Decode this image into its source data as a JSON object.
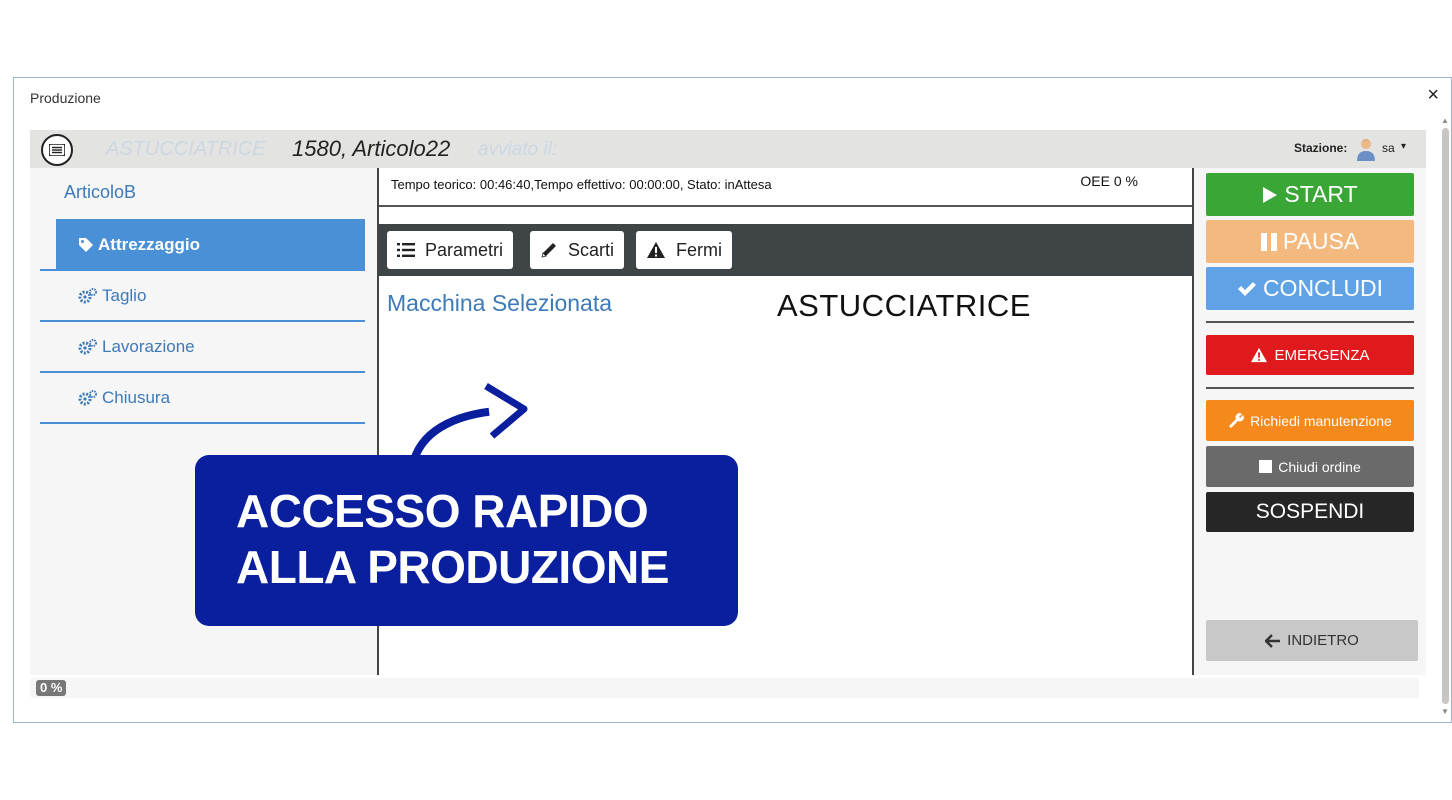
{
  "window": {
    "title": "Produzione",
    "close_glyph": "×"
  },
  "topbar": {
    "machine": "ASTUCCIATRICE",
    "order": "1580, Articolo22",
    "started": "avviato il:",
    "station_label": "Stazione:",
    "user": "sa",
    "caret": "▾"
  },
  "sidebar": {
    "header": "ArticoloB",
    "items": [
      {
        "label": "Attrezzaggio",
        "icon": "tag-icon",
        "active": true
      },
      {
        "label": "Taglio",
        "icon": "gears-icon",
        "active": false
      },
      {
        "label": "Lavorazione",
        "icon": "gears-icon",
        "active": false
      },
      {
        "label": "Chiusura",
        "icon": "gears-icon",
        "active": false
      }
    ]
  },
  "center": {
    "status": "Tempo teorico: 00:46:40,Tempo effettivo: 00:00:00, Stato: inAttesa",
    "oee": "OEE 0 %",
    "tabs": [
      {
        "label": "Parametri",
        "icon": "list-icon"
      },
      {
        "label": "Scarti",
        "icon": "pencil-icon"
      },
      {
        "label": "Fermi",
        "icon": "warning-icon"
      }
    ],
    "machine_label": "Macchina Selezionata",
    "machine_name": "ASTUCCIATRICE"
  },
  "actions": {
    "start": "START",
    "pause": "PAUSA",
    "conclude": "CONCLUDI",
    "emergency": "EMERGENZA",
    "maintenance": "Richiedi manutenzione",
    "close_order": "Chiudi ordine",
    "suspend": "SOSPENDI",
    "back": "INDIETRO"
  },
  "colors": {
    "start": "#3aa636",
    "pause": "#f4b97e",
    "conclude": "#5fa3e6",
    "emergency": "#e0191d",
    "maintenance": "#f5891b",
    "close_order": "#6a6a6a",
    "suspend": "#262626",
    "back": "#c8c8c8",
    "accent": "#4a90d6",
    "callout": "#0a1f9e"
  },
  "progress": {
    "label": "0 %",
    "value": 0
  },
  "callout": {
    "line1": "ACCESSO RAPIDO",
    "line2": "ALLA PRODUZIONE"
  }
}
